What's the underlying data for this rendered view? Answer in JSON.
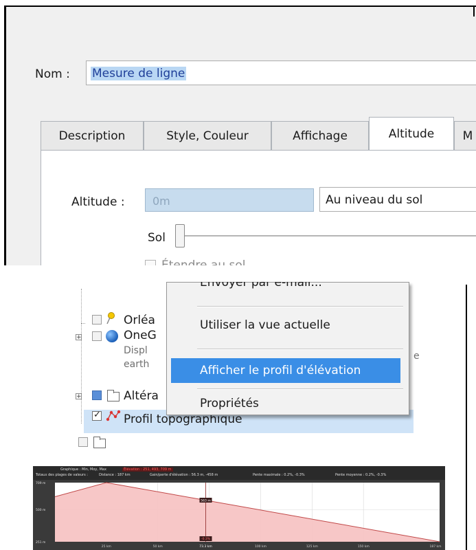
{
  "dialog": {
    "name_label": "Nom :",
    "name_value": "Mesure de ligne",
    "tabs": [
      {
        "label": "Description",
        "active": false
      },
      {
        "label": "Style, Couleur",
        "active": false
      },
      {
        "label": "Affichage",
        "active": false
      },
      {
        "label": "Altitude",
        "active": true
      },
      {
        "label": "M",
        "active": false
      }
    ],
    "altitude_label": "Altitude :",
    "altitude_value": "0m",
    "altitude_mode": "Au niveau du sol",
    "sol_label": "Sol",
    "extend_label": "Étendre au sol",
    "extend_checked": false
  },
  "layers": {
    "items": [
      {
        "label": "Orléa",
        "checked": false
      },
      {
        "label": "OneG",
        "checked": false
      },
      {
        "sub1": "Displ",
        "sub2": "earth",
        "sub_right": "e"
      },
      {
        "label": "Altéra",
        "checked": false
      },
      {
        "label": "Profil topographique",
        "checked": true
      }
    ],
    "context_menu": {
      "items": [
        "Envoyer par e-mail...",
        "Utiliser la vue actuelle",
        "Afficher le profil d'élévation",
        "Propriétés"
      ],
      "selected_index": 2
    }
  },
  "profile": {
    "header_line1_prefix": "Graphique : Min, Moy, Max",
    "header_line1_elev": "Élévation : 251, 493, 709 m",
    "header_line2": [
      "Totaux des plages de valeurs :",
      "Distance : 187 km",
      "Gain/perte d'élévation : 56.3 m, -458 m",
      "Pente maximale : 0.2%, -0.3%",
      "Pente moyenne : 0.2%, -0.3%"
    ],
    "cursor_elevation": "563 m",
    "cursor_slope": "-0.3%",
    "accent": "#e04040"
  },
  "chart_data": {
    "type": "area",
    "x": [
      0,
      25,
      187
    ],
    "y": [
      600,
      709,
      251
    ],
    "yticks": [
      "709 m",
      "500 m",
      "251 m"
    ],
    "xticks": [
      "25 km",
      "50 km",
      "73.3 km",
      "100 km",
      "125 km",
      "150 km",
      "187 km"
    ],
    "cursor_x": 73.3,
    "ylim": [
      251,
      709
    ],
    "xlim": [
      0,
      187
    ],
    "fill_color": "#f7c4c4",
    "line_color": "#c04848"
  }
}
